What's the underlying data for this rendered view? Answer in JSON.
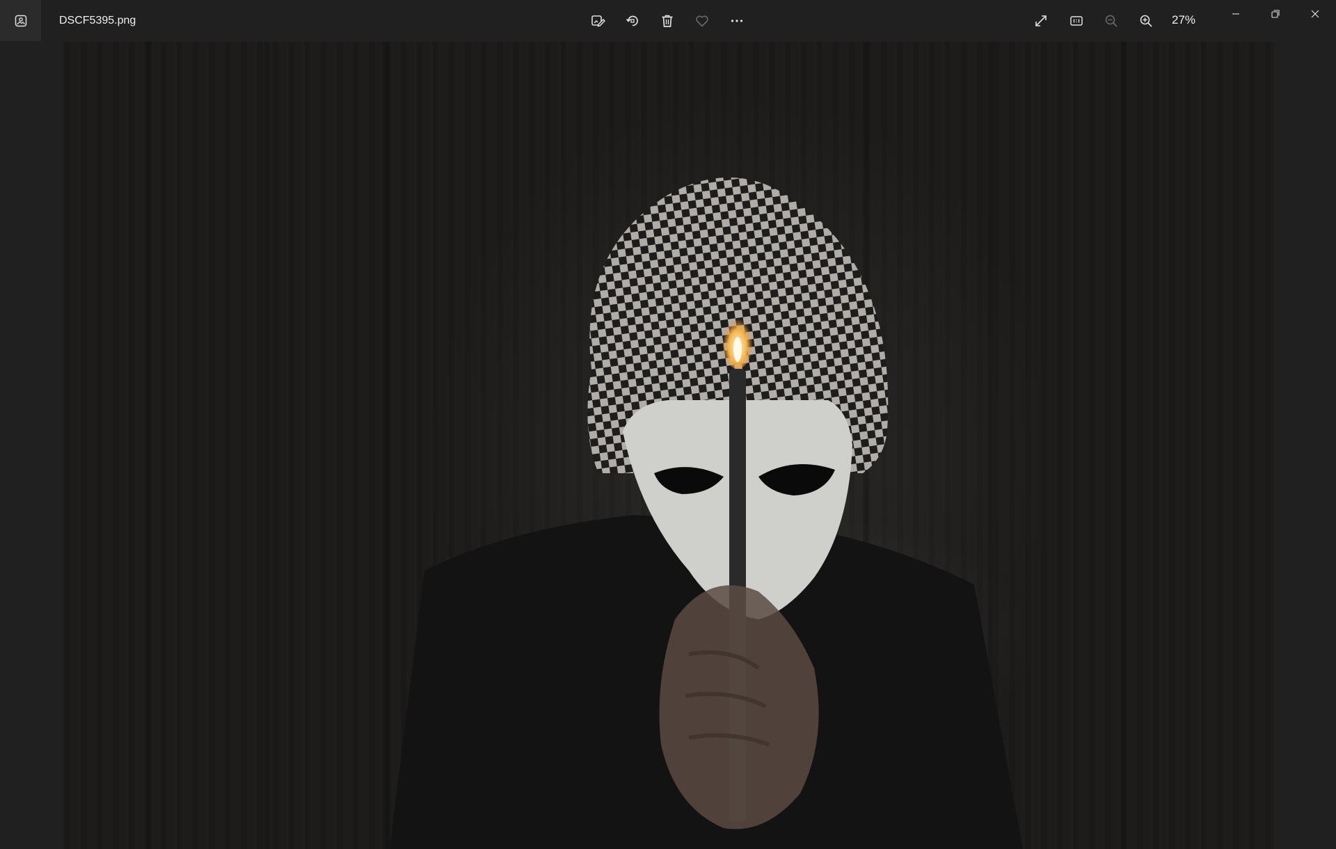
{
  "window": {
    "file_name": "DSCF5395.png",
    "zoom_level": "27%"
  },
  "toolbar": {
    "icons": [
      "edit-image-icon",
      "rotate-icon",
      "delete-icon",
      "favorite-icon",
      "more-options-icon"
    ],
    "right_icons": [
      "full-screen-icon",
      "actual-size-icon",
      "zoom-out-icon",
      "zoom-in-icon"
    ]
  },
  "window_controls": [
    "minimize-icon",
    "restore-icon",
    "close-icon"
  ],
  "colors": {
    "background": "#202020",
    "titlebar": "#202020",
    "icon": "#e0e0e0",
    "icon_disabled": "#6a6a6a"
  }
}
